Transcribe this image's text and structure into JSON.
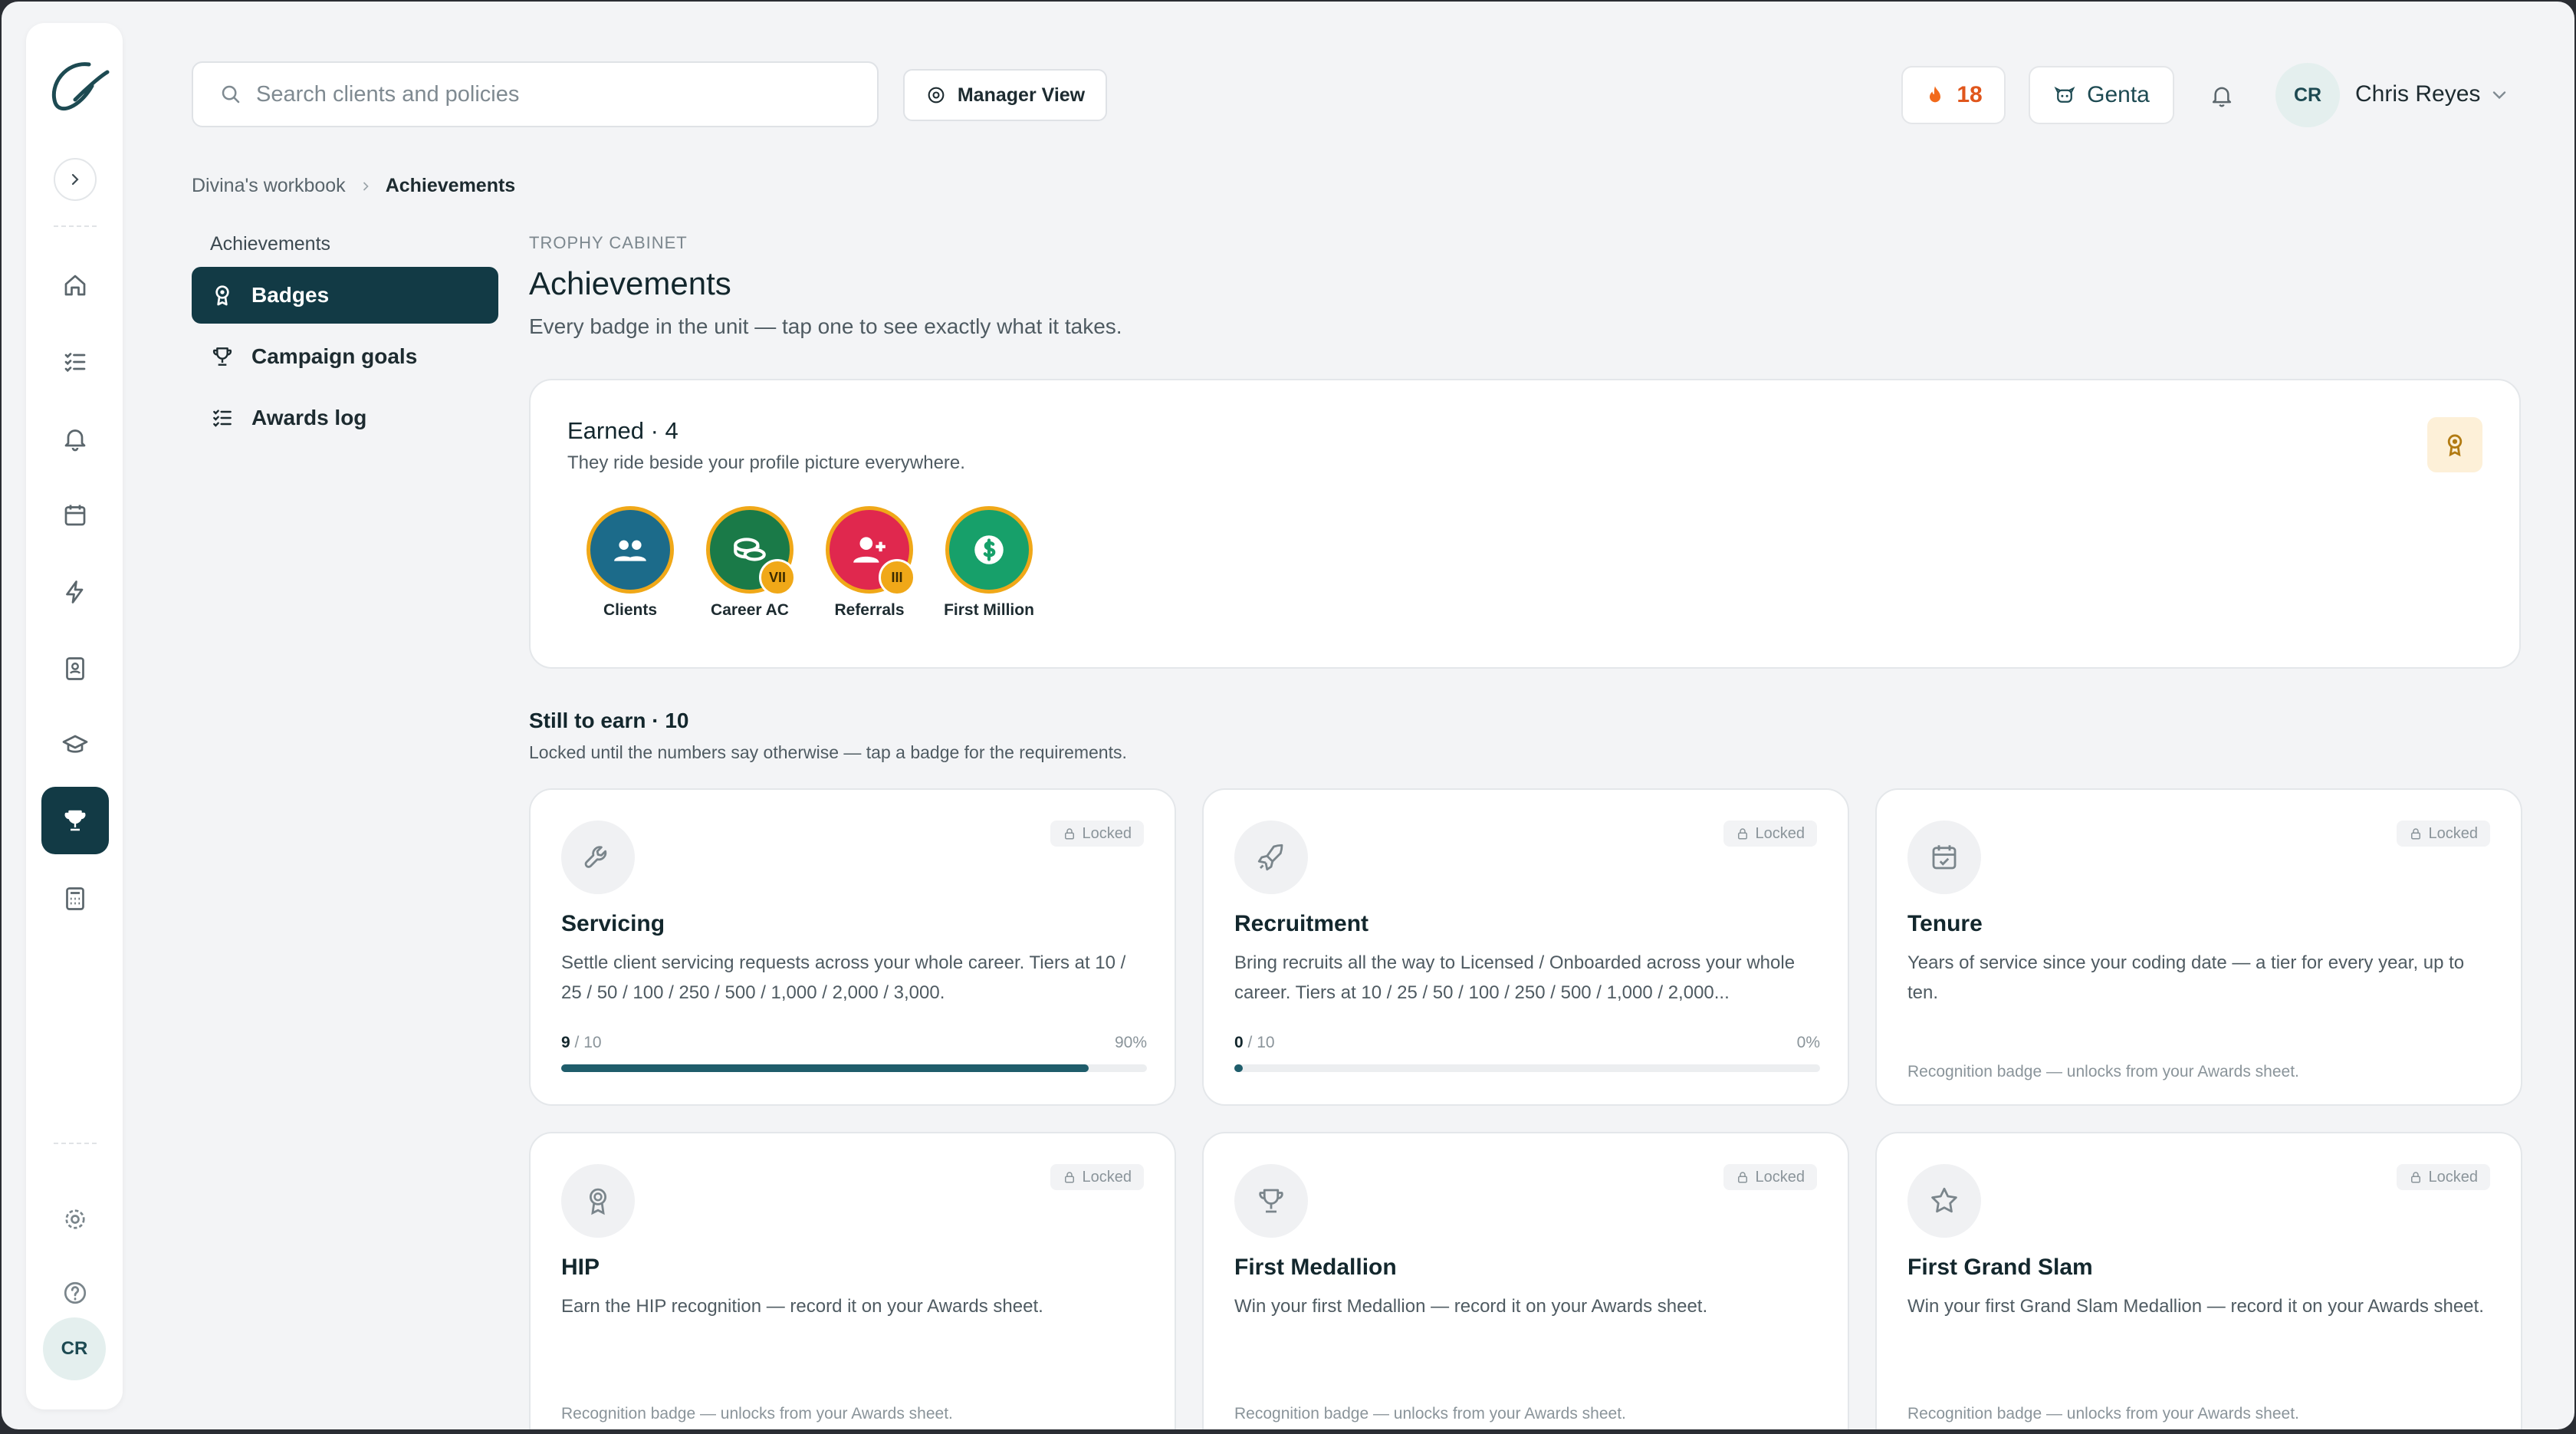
{
  "search": {
    "placeholder": "Search clients and policies"
  },
  "header": {
    "manager_view": "Manager View",
    "streak_count": "18",
    "genta_label": "Genta",
    "user_initials": "CR",
    "user_name": "Chris Reyes"
  },
  "rail": {
    "avatar_initials": "CR"
  },
  "breadcrumb": {
    "parent": "Divina's workbook",
    "current": "Achievements"
  },
  "subnav": {
    "title": "Achievements",
    "items": [
      {
        "label": "Badges"
      },
      {
        "label": "Campaign goals"
      },
      {
        "label": "Awards log"
      }
    ]
  },
  "main": {
    "eyebrow": "TROPHY CABINET",
    "title": "Achievements",
    "subtitle": "Every badge in the unit — tap one to see exactly what it takes."
  },
  "earned": {
    "title": "Earned · 4",
    "subtitle": "They ride beside your profile picture everywhere.",
    "badges": [
      {
        "label": "Clients",
        "tier": "",
        "color": "#1c6b8a"
      },
      {
        "label": "Career AC",
        "tier": "VII",
        "color": "#1a7a48"
      },
      {
        "label": "Referrals",
        "tier": "III",
        "color": "#e0284e"
      },
      {
        "label": "First Million",
        "tier": "",
        "color": "#17a06a"
      }
    ]
  },
  "still": {
    "title": "Still to earn · 10",
    "subtitle": "Locked until the numbers say otherwise — tap a badge for the requirements.",
    "locked_label": "Locked",
    "cards": [
      {
        "title": "Servicing",
        "desc": "Settle client servicing requests across your whole career. Tiers at 10 / 25 / 50 / 100 / 250 / 500 / 1,000 / 2,000 / 3,000.",
        "progress_current": "9",
        "progress_total": "/ 10",
        "progress_pct": "90%",
        "progress_value": 0.9,
        "icon": "wrench-icon"
      },
      {
        "title": "Recruitment",
        "desc": "Bring recruits all the way to Licensed / Onboarded across your whole career. Tiers at 10 / 25 / 50 / 100 / 250 / 500 / 1,000 / 2,000...",
        "progress_current": "0",
        "progress_total": "/ 10",
        "progress_pct": "0%",
        "progress_value": 0.0,
        "icon": "rocket-icon"
      },
      {
        "title": "Tenure",
        "desc": "Years of service since your coding date — a tier for every year, up to ten.",
        "foot": "Recognition badge — unlocks from your Awards sheet.",
        "icon": "calendar-check-icon"
      },
      {
        "title": "HIP",
        "desc": "Earn the HIP recognition — record it on your Awards sheet.",
        "foot": "Recognition badge — unlocks from your Awards sheet.",
        "icon": "ribbon-icon"
      },
      {
        "title": "First Medallion",
        "desc": "Win your first Medallion — record it on your Awards sheet.",
        "foot": "Recognition badge — unlocks from your Awards sheet.",
        "icon": "trophy-icon"
      },
      {
        "title": "First Grand Slam",
        "desc": "Win your first Grand Slam Medallion — record it on your Awards sheet.",
        "foot": "Recognition badge — unlocks from your Awards sheet.",
        "icon": "star-icon"
      }
    ]
  }
}
